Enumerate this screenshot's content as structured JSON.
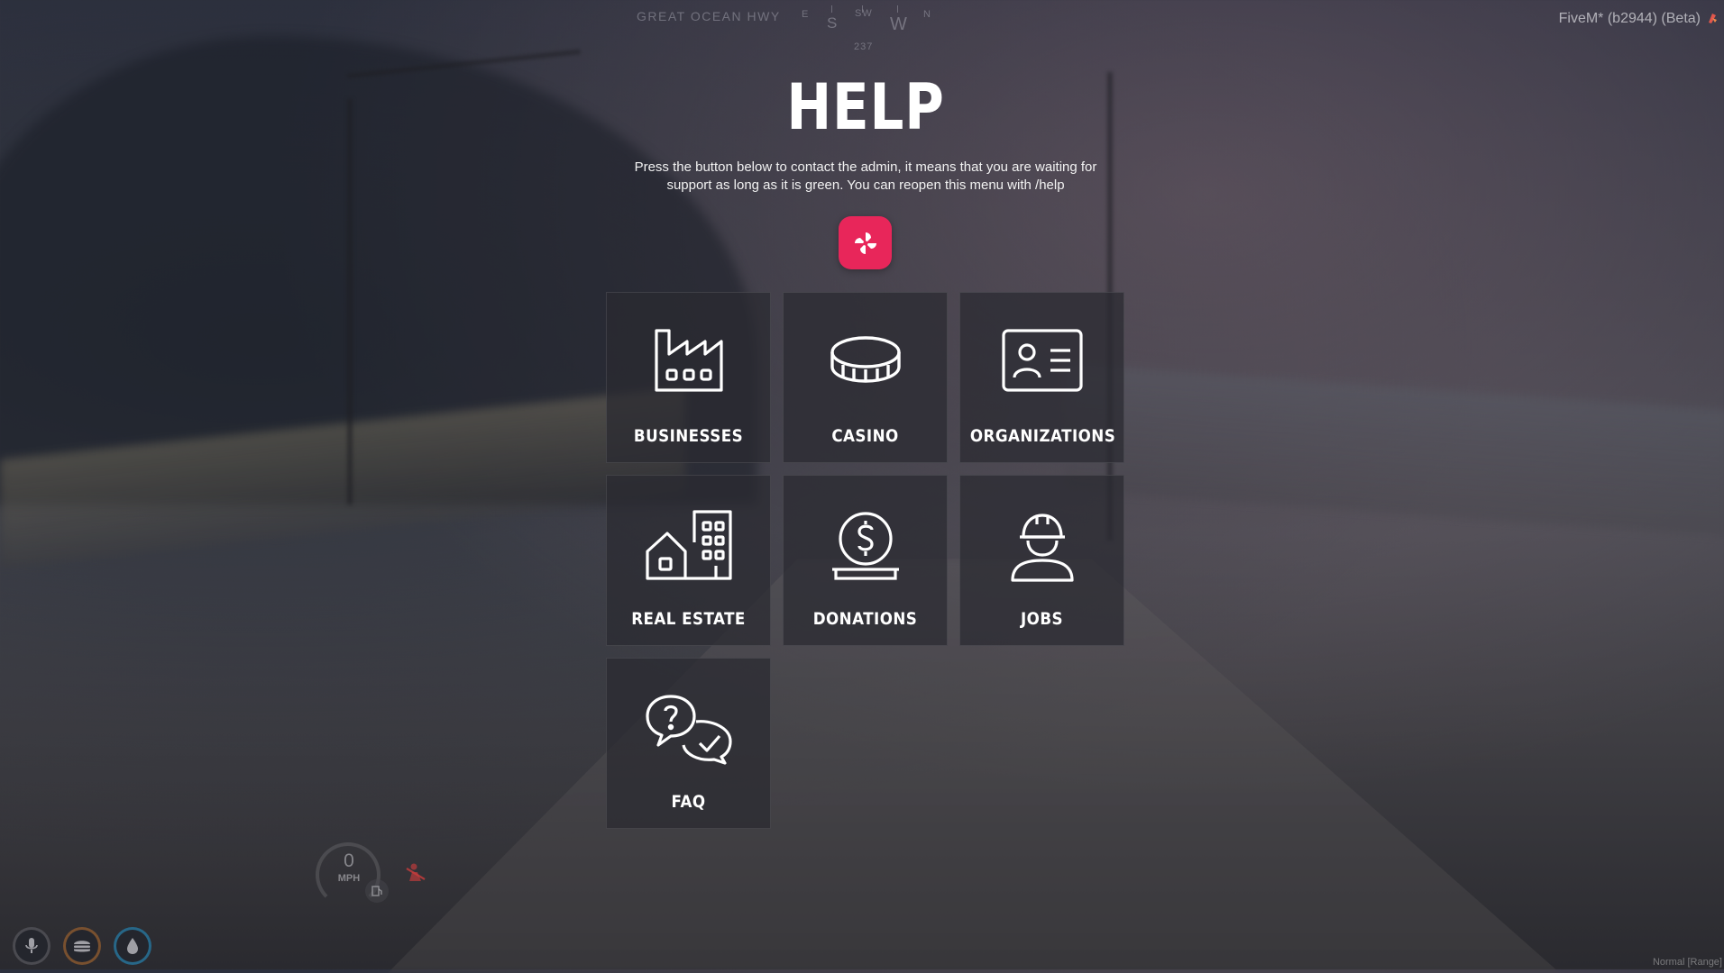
{
  "hud_top": {
    "street": "GREAT OCEAN HWY",
    "compass": {
      "e": "E",
      "s": "S",
      "sw": "SW",
      "w": "W",
      "n": "N",
      "degrees": "237"
    },
    "version": "FiveM* (b2944) (Beta)"
  },
  "help": {
    "title": "HELP",
    "description": "Press the button below to contact the admin, it means that you are waiting for support as long as it is green. You can reopen this menu with /help",
    "admin_button_color": "#e8265a",
    "categories": [
      {
        "label": "BUSINESSES",
        "icon": "factory-icon"
      },
      {
        "label": "CASINO",
        "icon": "coin-icon"
      },
      {
        "label": "ORGANIZATIONS",
        "icon": "id-card-icon"
      },
      {
        "label": "REAL ESTATE",
        "icon": "buildings-icon"
      },
      {
        "label": "DONATIONS",
        "icon": "donation-icon"
      },
      {
        "label": "JOBS",
        "icon": "worker-icon"
      },
      {
        "label": "FAQ",
        "icon": "faq-icon"
      }
    ]
  },
  "hud_bottom": {
    "speed_value": "0",
    "speed_unit": "MPH",
    "status_icons": [
      "microphone-icon",
      "food-icon",
      "water-icon"
    ],
    "footer": "Normal [Range]"
  },
  "colors": {
    "accent": "#e8265a",
    "card_bg": "rgba(42,42,48,0.72)"
  }
}
